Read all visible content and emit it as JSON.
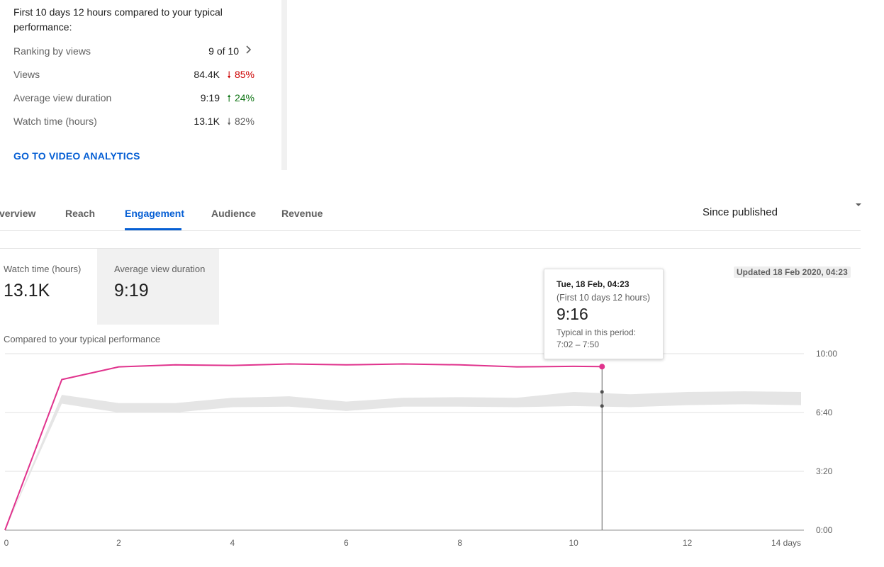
{
  "summary": {
    "heading": "First 10 days 12 hours compared to your typical performance:",
    "rows": [
      {
        "label": "Ranking by views",
        "value": "9 of 10"
      },
      {
        "label": "Views",
        "value": "84.4K",
        "change": "85%",
        "direction": "down"
      },
      {
        "label": "Average view duration",
        "value": "9:19",
        "change": "24%",
        "direction": "up"
      },
      {
        "label": "Watch time (hours)",
        "value": "13.1K",
        "change": "82%",
        "direction": "down"
      }
    ],
    "link": "GO TO VIDEO ANALYTICS"
  },
  "tabs": [
    {
      "label": "Overview",
      "display": "verview"
    },
    {
      "label": "Reach",
      "display": "Reach"
    },
    {
      "label": "Engagement",
      "display": "Engagement",
      "active": true
    },
    {
      "label": "Audience",
      "display": "Audience"
    },
    {
      "label": "Revenue",
      "display": "Revenue"
    }
  ],
  "period": "Since published",
  "metrics": [
    {
      "label": "Watch time (hours)",
      "value": "13.1K"
    },
    {
      "label": "Average view duration",
      "value": "9:19",
      "selected": true
    }
  ],
  "updated": "Updated 18 Feb 2020, 04:23",
  "compared_label": "Compared to your typical performance",
  "tooltip": {
    "date": "Tue, 18 Feb, 04:23",
    "period": "(First 10 days 12 hours)",
    "value": "9:16",
    "typical_label": "Typical in this period:",
    "typical_range": "7:02 – 7:50"
  },
  "colors": {
    "accent": "#065fd4",
    "series": "#e0338d",
    "typical_band": "#e5e5e5",
    "down": "#cc0000",
    "up": "#107516"
  },
  "icons": {
    "ranking_chevron": "chevron-right-icon",
    "period_caret": "dropdown-caret-icon",
    "down_arrow": "arrow-down-icon",
    "up_arrow": "arrow-up-icon"
  },
  "chart_data": {
    "type": "line",
    "x_ticks": [
      "0",
      "2",
      "4",
      "6",
      "8",
      "10",
      "12",
      "14 days"
    ],
    "y_ticks": [
      "0:00",
      "3:20",
      "6:40",
      "10:00"
    ],
    "xlim": [
      0,
      14
    ],
    "ylim_seconds": [
      0,
      600
    ],
    "grid": true,
    "series": [
      {
        "x": [
          0,
          1,
          2,
          3,
          4,
          5,
          6,
          7,
          8,
          9,
          10,
          10.5
        ],
        "y_seconds": [
          0,
          512,
          555,
          562,
          560,
          565,
          562,
          565,
          562,
          555,
          557,
          556
        ]
      }
    ],
    "typical_band": {
      "x": [
        1,
        2,
        3,
        4,
        5,
        6,
        7,
        8,
        9,
        10,
        11,
        12,
        13,
        14
      ],
      "low_seconds": [
        430,
        400,
        400,
        418,
        420,
        405,
        420,
        420,
        418,
        422,
        418,
        425,
        428,
        425
      ],
      "high_seconds": [
        460,
        432,
        432,
        450,
        455,
        437,
        450,
        452,
        450,
        470,
        462,
        470,
        472,
        470
      ]
    },
    "hover_x": 10.5,
    "hover_typical_seconds": [
      422,
      470
    ]
  }
}
